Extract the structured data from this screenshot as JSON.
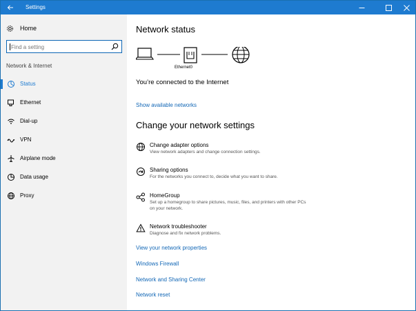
{
  "window": {
    "title": "Settings",
    "accent": "#1e7bd0"
  },
  "sidebar": {
    "home_label": "Home",
    "search_placeholder": "Find a setting",
    "section_label": "Network & Internet",
    "items": [
      {
        "label": "Status",
        "icon": "status-icon",
        "active": true
      },
      {
        "label": "Ethernet",
        "icon": "ethernet-icon",
        "active": false
      },
      {
        "label": "Dial-up",
        "icon": "dialup-icon",
        "active": false
      },
      {
        "label": "VPN",
        "icon": "vpn-icon",
        "active": false
      },
      {
        "label": "Airplane mode",
        "icon": "airplane-icon",
        "active": false
      },
      {
        "label": "Data usage",
        "icon": "data-usage-icon",
        "active": false
      },
      {
        "label": "Proxy",
        "icon": "globe-icon",
        "active": false
      }
    ]
  },
  "main": {
    "network_status_title": "Network status",
    "adapter_label": "Ethernet0",
    "connection_status": "You’re connected to the Internet",
    "show_networks_link": "Show available networks",
    "change_settings_title": "Change your network settings",
    "options": [
      {
        "title": "Change adapter options",
        "desc": "View network adapters and change connection settings.",
        "icon": "adapter-icon"
      },
      {
        "title": "Sharing options",
        "desc": "For the networks you connect to, decide what you want to share.",
        "icon": "sharing-icon"
      },
      {
        "title": "HomeGroup",
        "desc": "Set up a homegroup to share pictures, music, files, and printers with other PCs on your network.",
        "icon": "homegroup-icon"
      },
      {
        "title": "Network troubleshooter",
        "desc": "Diagnose and fix network problems.",
        "icon": "warning-icon"
      }
    ],
    "links": [
      "View your network properties",
      "Windows Firewall",
      "Network and Sharing Center",
      "Network reset"
    ]
  }
}
